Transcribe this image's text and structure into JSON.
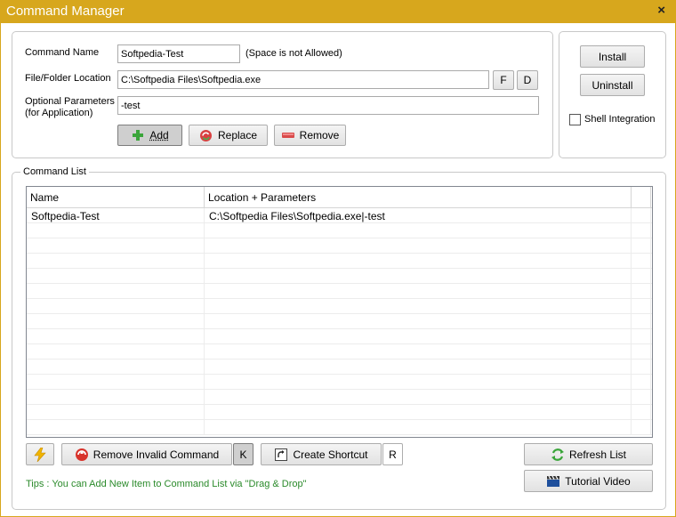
{
  "window": {
    "title": "Command Manager",
    "close_glyph": "×"
  },
  "form": {
    "command_name_label": "Command Name",
    "command_name_value": "Softpedia-Test",
    "command_name_hint": "(Space is not Allowed)",
    "location_label": "File/Folder Location",
    "location_value": "C:\\Softpedia Files\\Softpedia.exe",
    "file_button": "F",
    "folder_button": "D",
    "params_label_line1": "Optional Parameters",
    "params_label_line2": "(for Application)",
    "params_value": "-test",
    "add_button": "Add",
    "replace_button": "Replace",
    "remove_button": "Remove"
  },
  "side": {
    "install_button": "Install",
    "uninstall_button": "Uninstall",
    "shell_integration_label": "Shell Integration",
    "shell_integration_checked": false
  },
  "command_list": {
    "legend": "Command List",
    "columns": [
      "Name",
      "Location + Parameters"
    ],
    "rows": [
      {
        "name": "Softpedia-Test",
        "location": "C:\\Softpedia Files\\Softpedia.exe|-test"
      }
    ]
  },
  "bottom": {
    "remove_invalid_button": "Remove Invalid Command",
    "k_button": "K",
    "create_shortcut_button": "Create Shortcut",
    "r_button": "R",
    "refresh_button": "Refresh List",
    "tutorial_button": "Tutorial Video",
    "tips": "Tips : You can Add New Item to Command List via \"Drag & Drop\""
  },
  "colors": {
    "titlebar": "#d7a71d",
    "tips": "#2a8a2a"
  }
}
